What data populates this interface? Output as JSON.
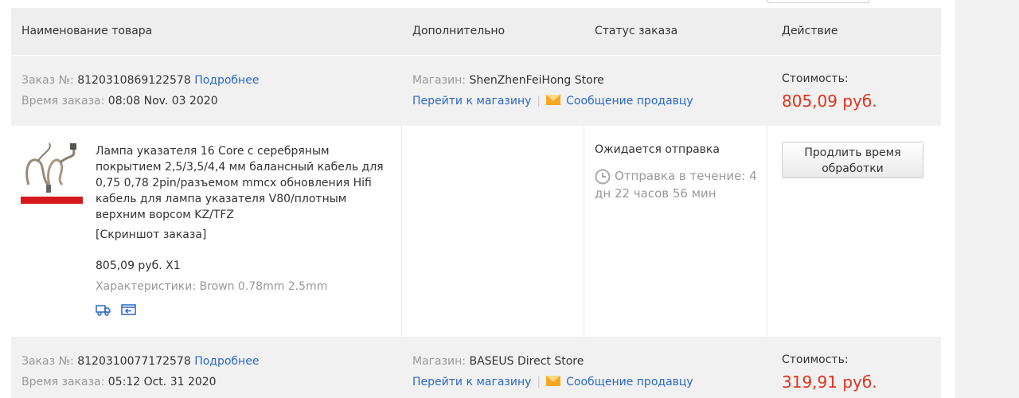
{
  "table_header": {
    "name": "Наименование товара",
    "additional": "Дополнительно",
    "status": "Статус заказа",
    "action": "Действие"
  },
  "orders": [
    {
      "order_label": "Заказ №:",
      "order_number": "8120310869122578",
      "details_link": "Подробнее",
      "time_label": "Время заказа:",
      "time_value": "08:08 Nov. 03 2020",
      "store_label": "Магазин:",
      "store_name": "ShenZhenFeiHong Store",
      "goto_store": "Перейти к магазину",
      "separator": "|",
      "message_seller": "Сообщение продавцу",
      "cost_label": "Стоимость:",
      "cost_value": "805,09 руб.",
      "item": {
        "title_lines": [
          "Лампа указателя 16 Core с серебряным",
          "покрытием 2,5/3,5/4,4 мм балансный кабель для",
          "0,75 0,78 2pin/разъемом mmcx обновления Hifi",
          "кабель для лампа указателя V80/плотным",
          "верхним ворсом KZ/TFZ"
        ],
        "snapshot": "[Скриншот заказа]",
        "price_qty": "805,09 руб. X1",
        "characteristics": "Характеристики: Brown 0.78mm 2.5mm",
        "status": "Ожидается отправка",
        "shipping_lines": [
          "Отправка в течение: 4",
          "дн 22 часов 56 мин"
        ],
        "action_button_lines": [
          "Продлить время",
          "обработки"
        ]
      }
    },
    {
      "order_label": "Заказ №:",
      "order_number": "8120310077172578",
      "details_link": "Подробнее",
      "time_label": "Время заказа:",
      "time_value": "05:12 Oct. 31 2020",
      "store_label": "Магазин:",
      "store_name": "BASEUS Direct Store",
      "goto_store": "Перейти к магазину",
      "separator": "|",
      "message_seller": "Сообщение продавцу",
      "cost_label": "Стоимость:",
      "cost_value": "319,91 руб."
    }
  ],
  "icons": {
    "mail": "envelope-icon",
    "clock": "clock-icon",
    "delivery": "delivery-truck-icon",
    "return": "return-icon"
  },
  "colors": {
    "link": "#2b69c7",
    "price": "#e3311b",
    "muted": "#999999",
    "mail_icon": "#f5a623",
    "thumb_strip": "#d6191d"
  }
}
